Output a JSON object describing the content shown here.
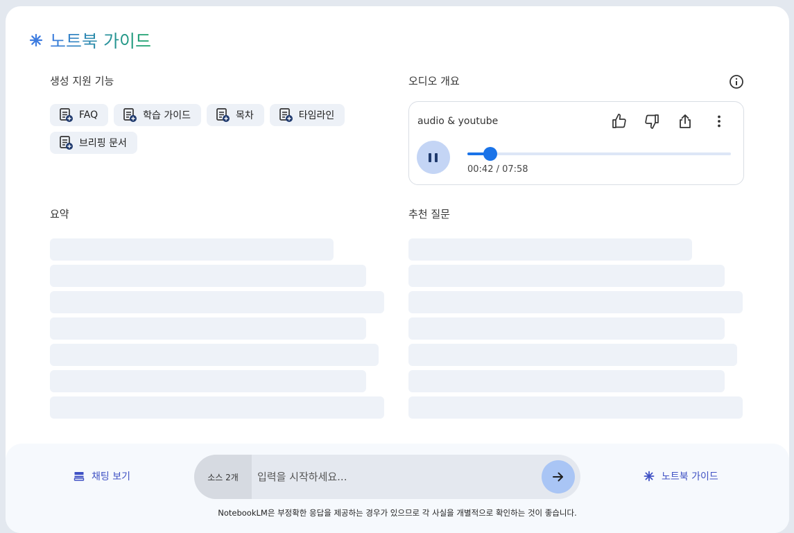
{
  "header": {
    "title": "노트북 가이드"
  },
  "features": {
    "label": "생성 지원 기능",
    "chips": [
      {
        "label": "FAQ"
      },
      {
        "label": "학습 가이드"
      },
      {
        "label": "목차"
      },
      {
        "label": "타임라인"
      },
      {
        "label": "브리핑 문서"
      }
    ]
  },
  "audio": {
    "label": "오디오 개요",
    "title": "audio & youtube",
    "time": "00:42 / 07:58",
    "progress_fraction": 0.088,
    "accent": "#1a73e8"
  },
  "summary": {
    "label": "요약"
  },
  "questions": {
    "label": "추천 질문"
  },
  "footer": {
    "chat_link": "채팅 보기",
    "source_count": "소스 2개",
    "input_placeholder": "입력을 시작하세요...",
    "guide_link": "노트북 가이드",
    "disclaimer": "NotebookLM은 부정확한 응답을 제공하는 경우가 있으므로 각 사실을 개별적으로 확인하는 것이 좋습니다."
  }
}
